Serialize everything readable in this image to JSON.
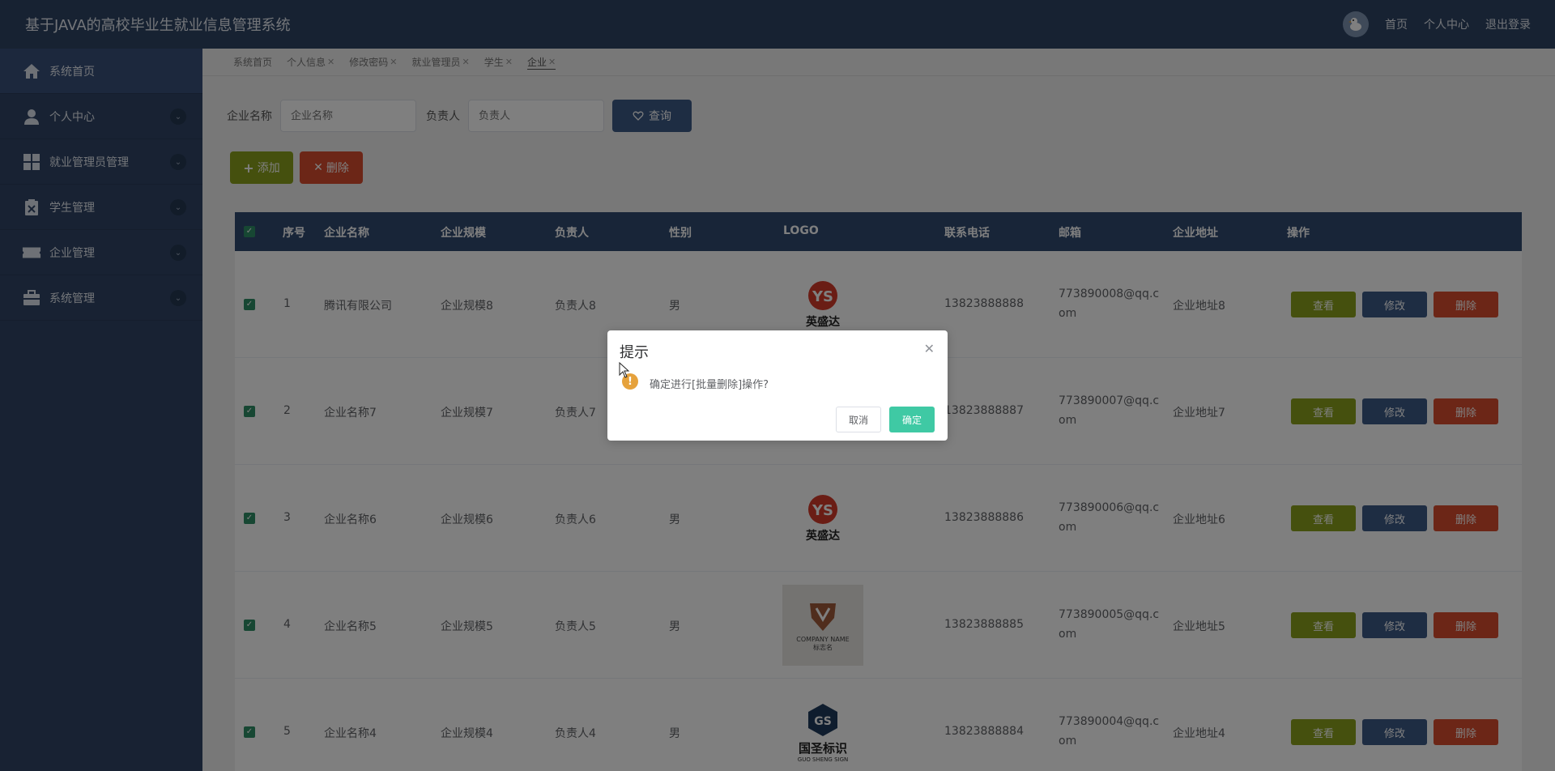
{
  "header": {
    "title": "基于JAVA的高校毕业生就业信息管理系统",
    "links": [
      "首页",
      "个人中心",
      "退出登录"
    ]
  },
  "sidebar": {
    "items": [
      {
        "label": "系统首页",
        "icon": "home-icon"
      },
      {
        "label": "个人中心",
        "icon": "user-icon"
      },
      {
        "label": "就业管理员管理",
        "icon": "grid-icon"
      },
      {
        "label": "学生管理",
        "icon": "clipboard-icon"
      },
      {
        "label": "企业管理",
        "icon": "ticket-icon"
      },
      {
        "label": "系统管理",
        "icon": "briefcase-icon"
      }
    ]
  },
  "tabs": [
    {
      "label": "系统首页",
      "closable": false
    },
    {
      "label": "个人信息",
      "closable": true
    },
    {
      "label": "修改密码",
      "closable": true
    },
    {
      "label": "就业管理员",
      "closable": true
    },
    {
      "label": "学生",
      "closable": true
    },
    {
      "label": "企业",
      "closable": true
    }
  ],
  "search": {
    "company_label": "企业名称",
    "company_placeholder": "企业名称",
    "owner_label": "负责人",
    "owner_placeholder": "负责人",
    "query_label": "查询"
  },
  "actions": {
    "add_label": "添加",
    "delete_label": "删除"
  },
  "table": {
    "headers": [
      "序号",
      "企业名称",
      "企业规模",
      "负责人",
      "性别",
      "LOGO",
      "联系电话",
      "邮箱",
      "企业地址",
      "操作"
    ],
    "rows": [
      {
        "no": "1",
        "name": "腾讯有限公司",
        "scale": "企业规模8",
        "owner": "负责人8",
        "gender": "男",
        "logo": "英盛达",
        "phone": "13823888888",
        "email1": "773890008@qq.c",
        "email2": "om",
        "address": "企业地址8"
      },
      {
        "no": "2",
        "name": "企业名称7",
        "scale": "企业规模7",
        "owner": "负责人7",
        "gender": "",
        "logo": "",
        "phone": "13823888887",
        "email1": "773890007@qq.c",
        "email2": "om",
        "address": "企业地址7"
      },
      {
        "no": "3",
        "name": "企业名称6",
        "scale": "企业规模6",
        "owner": "负责人6",
        "gender": "男",
        "logo": "英盛达",
        "phone": "13823888886",
        "email1": "773890006@qq.c",
        "email2": "om",
        "address": "企业地址6"
      },
      {
        "no": "4",
        "name": "企业名称5",
        "scale": "企业规模5",
        "owner": "负责人5",
        "gender": "男",
        "logo": "COMPANY NAME",
        "logo_sub": "标志名",
        "phone": "13823888885",
        "email1": "773890005@qq.c",
        "email2": "om",
        "address": "企业地址5"
      },
      {
        "no": "5",
        "name": "企业名称4",
        "scale": "企业规模4",
        "owner": "负责人4",
        "gender": "男",
        "logo": "国圣标识",
        "logo_sub": "GUO SHENG SIGN",
        "phone": "13823888884",
        "email1": "773890004@qq.c",
        "email2": "om",
        "address": "企业地址4"
      }
    ],
    "row_buttons": {
      "view": "查看",
      "edit": "修改",
      "remove": "删除"
    }
  },
  "dialog": {
    "title": "提示",
    "message": "确定进行[批量删除]操作?",
    "cancel": "取消",
    "confirm": "确定"
  },
  "colors": {
    "header_bg": "#2f4565",
    "sidebar_bg": "#304566",
    "view_btn": "#8aa11c",
    "edit_btn": "#3d5a87",
    "delete_btn": "#d84d2e",
    "confirm_btn": "#3fc9a4",
    "warning": "#e6a23c"
  }
}
